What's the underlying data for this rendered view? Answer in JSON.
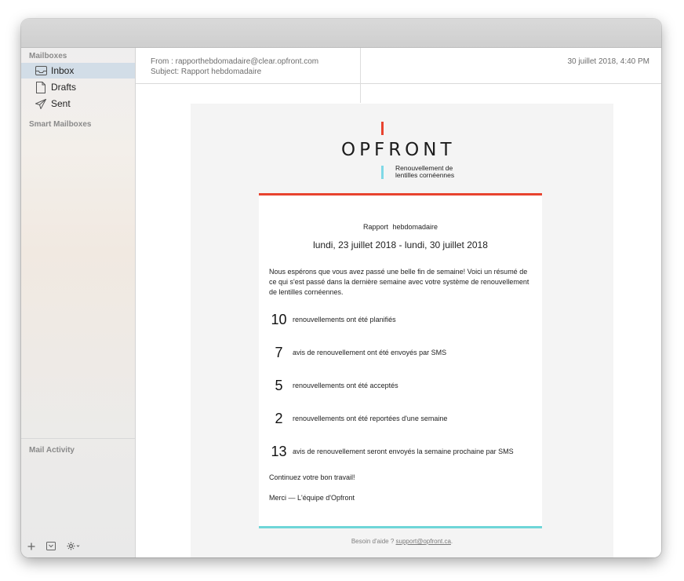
{
  "sidebar": {
    "mailboxes_heading": "Mailboxes",
    "items": [
      {
        "label": "Inbox",
        "icon": "inbox-icon"
      },
      {
        "label": "Drafts",
        "icon": "drafts-icon"
      },
      {
        "label": "Sent",
        "icon": "sent-icon"
      }
    ],
    "smart_heading": "Smart Mailboxes",
    "activity_heading": "Mail Activity",
    "bottom_icons": [
      "add-icon",
      "mailbox-icon",
      "gear-icon"
    ]
  },
  "message": {
    "from": "From : rapporthebdomadaire@clear.opfront.com",
    "subject": "Subject: Rapport hebdomadaire",
    "date": "30 juillet 2018, 4:40 PM"
  },
  "email": {
    "logo_text": "OPFRONT",
    "logo_sub_1": "Renouvellement de",
    "logo_sub_2": "lentilles cornéennes",
    "title": "Rapport hebdomadaire",
    "range": "lundi, 23 juillet 2018 - lundi, 30 juillet 2018",
    "intro": "Nous espérons que vous avez passé une belle fin de semaine! Voici un résumé de ce qui s'est passé dans la dernière semaine avec votre système de renouvellement de lentilles cornéennes.",
    "stats": [
      {
        "num": "10",
        "text": "renouvellements ont été planifiés"
      },
      {
        "num": "7",
        "text": "avis de renouvellement ont été envoyés par SMS"
      },
      {
        "num": "5",
        "text": "renouvellements ont été acceptés"
      },
      {
        "num": "2",
        "text": "renouvellements ont été reportées d'une semaine"
      },
      {
        "num": "13",
        "text": "avis de renouvellement seront envoyés la semaine prochaine par SMS"
      }
    ],
    "closing_1": "Continuez votre bon travail!",
    "closing_2": "Merci — L'équipe d'Opfront",
    "footer_prefix": "Besoin d'aide ? ",
    "footer_link": "support@opfront.ca",
    "footer_suffix": "."
  },
  "colors": {
    "accent_red": "#e8432f",
    "accent_cyan": "#6fd6d8",
    "selection": "#d2dde7"
  }
}
